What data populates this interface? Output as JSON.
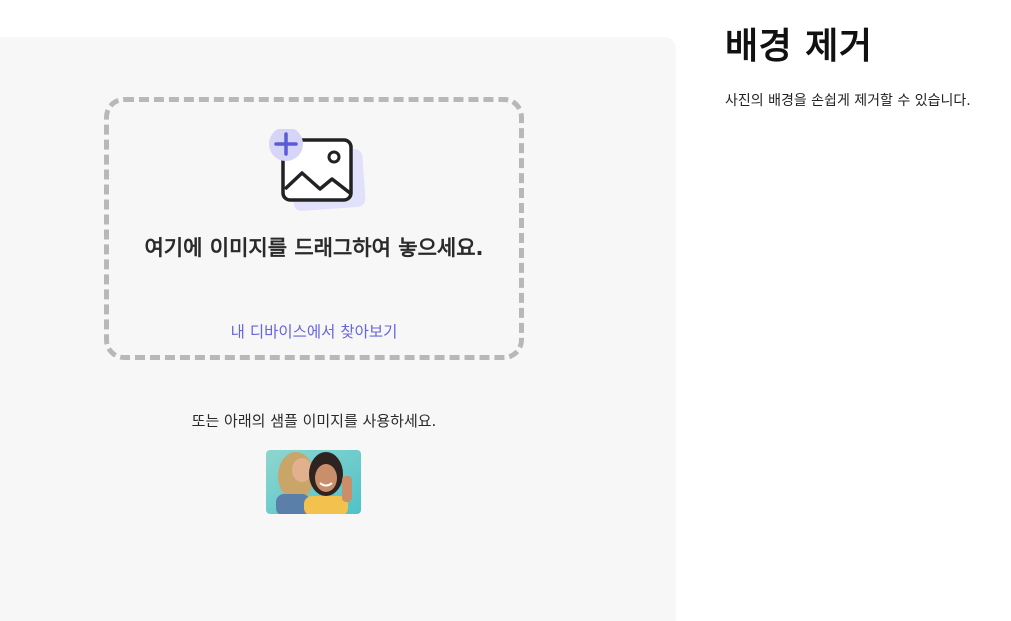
{
  "main": {
    "title": "배경 제거",
    "subtitle": "사진의 배경을 손쉽게 제거할 수 있습니다."
  },
  "dropzone": {
    "icon": "image-add-icon",
    "title": "여기에 이미지를 드래그하여 놓으세요.",
    "browse_label": "내 디바이스에서 찾아보기"
  },
  "samples": {
    "label": "또는 아래의 샘플 이미지를 사용하세요.",
    "thumbnail_icon": "sample-photo-two-women"
  },
  "colors": {
    "accent": "#6766d9",
    "accent_light": "#d9d9f7",
    "panel_bg": "#f7f7f7",
    "dash_border": "#b8b8b8"
  }
}
